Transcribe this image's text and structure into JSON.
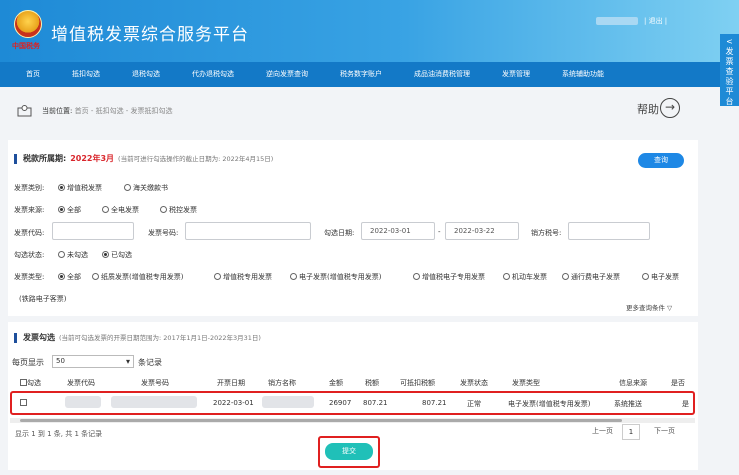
{
  "header": {
    "emblem_text": "中国税务",
    "title": "增值税发票综合服务平台",
    "logout": "| 退出 |"
  },
  "nav": [
    "首页",
    "抵扣勾选",
    "退税勾选",
    "代办退税勾选",
    "逆向发票查询",
    "税务数字账户",
    "成品油消费税管理",
    "发票管理",
    "系统辅助功能"
  ],
  "side_float": [
    "<",
    "发",
    "票",
    "查",
    "验",
    "平",
    "台"
  ],
  "breadcrumb": {
    "label": "当前位置:",
    "path": "首页 - 抵扣勾选 - 发票抵扣勾选"
  },
  "help": {
    "label": "帮助",
    "arrow": "→"
  },
  "tax_period": {
    "label": "税款所属期:",
    "value": "2022年3月",
    "hint": "(当前可进行勾选操作的截止日期为: 2022年4月15日)",
    "query_button": "查询"
  },
  "filters": {
    "invoice_category_label": "发票类别:",
    "invoice_category_options": [
      "增值税发票",
      "海关缴款书"
    ],
    "source_label": "发票来源:",
    "source_options": [
      "全部",
      "全电发票",
      "税控发票"
    ],
    "code_label": "发票代码:",
    "number_label": "发票号码:",
    "date_label": "勾选日期:",
    "date_start": "2022-03-01",
    "date_sep": "-",
    "date_end": "2022-03-22",
    "seller_tax_label": "销方税号:",
    "status_label": "勾选状态:",
    "status_options": [
      "未勾选",
      "已勾选"
    ],
    "type_label": "发票类型:",
    "type_options": [
      "全部",
      "纸质发票(增值税专用发票)",
      "增值税专用发票",
      "电子发票(增值税专用发票)",
      "增值税电子专用发票",
      "机动车发票",
      "通行费电子发票",
      "电子发票"
    ],
    "type_overflow": "(铁路电子客票)",
    "more_conditions": "更多查询条件 ▽"
  },
  "selection": {
    "title": "发票勾选",
    "hint": "(当前可勾选发票的开票日期范围为: 2017年1月1日-2022年3月31日)",
    "per_page_label": "每页显示",
    "per_page_value": "50",
    "per_page_suffix": "条记录"
  },
  "table": {
    "columns": [
      "勾选",
      "发票代码",
      "发票号码",
      "开票日期",
      "销方名称",
      "金额",
      "税额",
      "可抵扣税额",
      "发票状态",
      "发票类型",
      "信息来源",
      "是否"
    ],
    "row": {
      "date": "2022-03-01",
      "amount": "26907",
      "tax": "807.21",
      "deductible": "807.21",
      "status": "正常",
      "type": "电子发票(增值税专用发票)",
      "source": "系统推送",
      "flag": "是"
    }
  },
  "footer": {
    "summary": "显示 1 到 1 条, 共 1 条记录",
    "prev": "上一页",
    "page": "1",
    "next": "下一页",
    "submit": "提交"
  }
}
